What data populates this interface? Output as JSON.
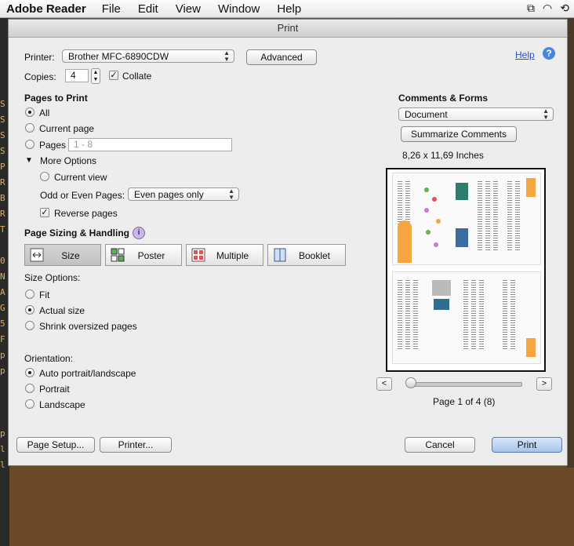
{
  "menubar": {
    "app_name": "Adobe Reader",
    "items": [
      "File",
      "Edit",
      "View",
      "Window",
      "Help"
    ]
  },
  "background_text": [
    "S",
    "S",
    "S",
    "S",
    "P",
    "R",
    "B",
    "R",
    "T",
    "",
    "0",
    "N",
    "A",
    "G",
    "5",
    "F",
    "p",
    "p",
    "",
    "",
    "",
    "p",
    "l",
    "l"
  ],
  "dialog": {
    "title": "Print",
    "printer_label": "Printer:",
    "printer_value": "Brother MFC-6890CDW",
    "advanced_button": "Advanced",
    "help_link": "Help",
    "copies_label": "Copies:",
    "copies_value": "4",
    "collate_label": "Collate",
    "collate_checked": true,
    "pages_to_print": {
      "heading": "Pages to Print",
      "all": "All",
      "current_page": "Current page",
      "pages": "Pages",
      "pages_placeholder": "1 - 8",
      "selected": "all"
    },
    "more_options": {
      "label": "More Options",
      "current_view": "Current view",
      "odd_even_label": "Odd or Even Pages:",
      "odd_even_value": "Even pages only",
      "reverse_pages": "Reverse pages",
      "reverse_checked": true
    },
    "page_sizing": {
      "heading": "Page Sizing & Handling",
      "tabs": [
        "Size",
        "Poster",
        "Multiple",
        "Booklet"
      ],
      "active_tab": "Size",
      "size_options_label": "Size Options:",
      "fit": "Fit",
      "actual_size": "Actual size",
      "shrink": "Shrink oversized pages",
      "selected": "actual_size"
    },
    "orientation": {
      "label": "Orientation:",
      "auto": "Auto portrait/landscape",
      "portrait": "Portrait",
      "landscape": "Landscape",
      "selected": "auto"
    },
    "comments_forms": {
      "heading": "Comments & Forms",
      "value": "Document",
      "summarize_button": "Summarize Comments"
    },
    "preview": {
      "paper_size": "8,26 x 11,69 Inches",
      "page_indicator": "Page 1 of 4 (8)",
      "prev_label": "<",
      "next_label": ">"
    },
    "footer": {
      "page_setup_button": "Page Setup...",
      "printer_button": "Printer...",
      "cancel_button": "Cancel",
      "print_button": "Print"
    },
    "accent_color": "#3b6fd8",
    "default_button_color": "#a9c4ea"
  }
}
